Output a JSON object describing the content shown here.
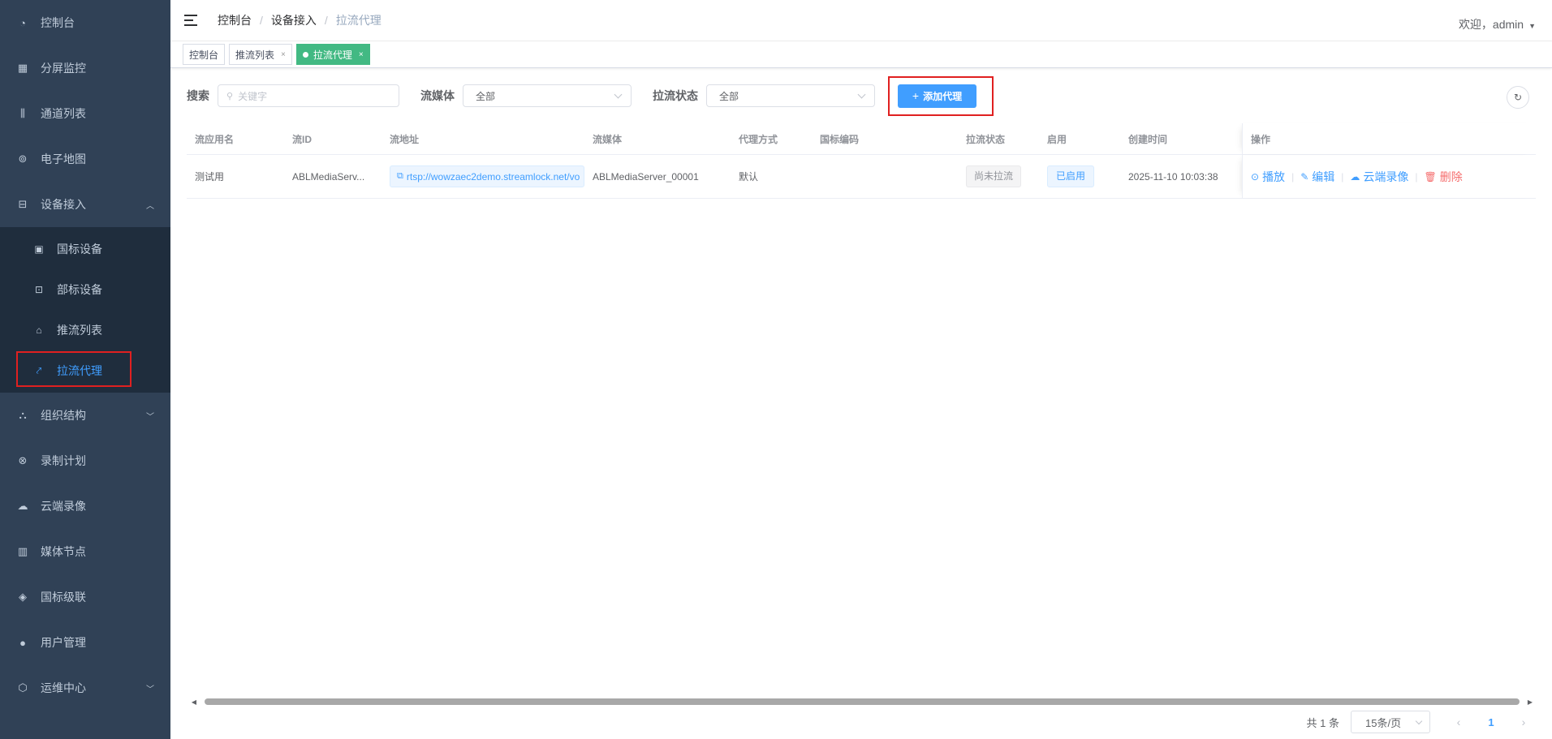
{
  "sidebar": {
    "items": [
      {
        "label": "控制台",
        "icon": "dashboard-icon"
      },
      {
        "label": "分屏监控",
        "icon": "grid-icon"
      },
      {
        "label": "通道列表",
        "icon": "sliders-icon"
      },
      {
        "label": "电子地图",
        "icon": "map-pin-icon"
      },
      {
        "label": "设备接入",
        "icon": "device-icon",
        "expanded": true
      },
      {
        "label": "组织结构",
        "icon": "org-tree-icon"
      },
      {
        "label": "录制计划",
        "icon": "record-plan-icon"
      },
      {
        "label": "云端录像",
        "icon": "cloud-icon"
      },
      {
        "label": "媒体节点",
        "icon": "media-node-icon"
      },
      {
        "label": "国标级联",
        "icon": "layers-icon"
      },
      {
        "label": "用户管理",
        "icon": "user-icon"
      },
      {
        "label": "运维中心",
        "icon": "ops-icon"
      }
    ],
    "sub_items": [
      {
        "label": "国标设备",
        "icon": "gb-device-icon"
      },
      {
        "label": "部标设备",
        "icon": "bus-icon"
      },
      {
        "label": "推流列表",
        "icon": "push-stream-icon"
      },
      {
        "label": "拉流代理",
        "icon": "pull-proxy-icon",
        "active": true
      }
    ]
  },
  "header": {
    "breadcrumb": [
      "控制台",
      "设备接入",
      "拉流代理"
    ],
    "user_greeting": "欢迎，admin"
  },
  "tags": [
    {
      "label": "控制台",
      "closable": false
    },
    {
      "label": "推流列表",
      "closable": true
    },
    {
      "label": "拉流代理",
      "closable": true,
      "active": true
    }
  ],
  "toolbar": {
    "search_label": "搜索",
    "search_placeholder": "关键字",
    "media_label": "流媒体",
    "media_value": "全部",
    "status_label": "拉流状态",
    "status_value": "全部",
    "add_button": "添加代理"
  },
  "table": {
    "columns": [
      "流应用名",
      "流ID",
      "流地址",
      "流媒体",
      "代理方式",
      "国标编码",
      "拉流状态",
      "启用",
      "创建时间",
      "操作"
    ],
    "rows": [
      {
        "app": "测试用",
        "stream_id": "ABLMediaServ...",
        "url": "rtsp://wowzaec2demo.streamlock.net/vo",
        "media": "ABLMediaServer_00001",
        "proxy_type": "默认",
        "gb_code": "",
        "pull_status": "尚未拉流",
        "enabled": "已启用",
        "created": "2025-11-10 10:03:38",
        "actions": [
          "播放",
          "编辑",
          "云端录像",
          "删除"
        ]
      }
    ]
  },
  "pagination": {
    "total": "共 1 条",
    "page_size": "15条/页",
    "current_page": "1"
  },
  "colors": {
    "sidebar_bg": "#304156",
    "primary": "#409eff",
    "tag_active": "#42b983",
    "danger": "#f56c6c",
    "highlight_box": "#e02020"
  }
}
